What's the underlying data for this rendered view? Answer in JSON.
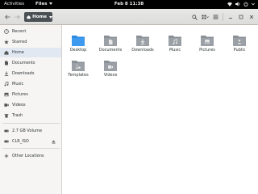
{
  "topbar": {
    "activities_label": "Activities",
    "app_menu_label": "Files",
    "clock": "Feb 8  11:38"
  },
  "headerbar": {
    "path_label": "Home"
  },
  "sidebar": {
    "items": [
      {
        "label": "Recent",
        "icon": "clock-icon"
      },
      {
        "label": "Starred",
        "icon": "star-icon"
      },
      {
        "label": "Home",
        "icon": "home-icon"
      },
      {
        "label": "Documents",
        "icon": "document-icon"
      },
      {
        "label": "Downloads",
        "icon": "download-icon"
      },
      {
        "label": "Music",
        "icon": "music-icon"
      },
      {
        "label": "Pictures",
        "icon": "picture-icon"
      },
      {
        "label": "Videos",
        "icon": "video-icon"
      },
      {
        "label": "Trash",
        "icon": "trash-icon"
      },
      {
        "label": "2.7 GB Volume",
        "icon": "drive-icon"
      },
      {
        "label": "CLR_ISO",
        "icon": "drive-icon"
      },
      {
        "label": "Other Locations",
        "icon": "plus-icon"
      }
    ],
    "active": "Home"
  },
  "folders": [
    {
      "label": "Desktop",
      "icon": "desktop-folder-icon",
      "color": "#2c8be0"
    },
    {
      "label": "Documents",
      "icon": "documents-folder-icon",
      "color": "#9aa0a6"
    },
    {
      "label": "Downloads",
      "icon": "downloads-folder-icon",
      "color": "#9aa0a6"
    },
    {
      "label": "Music",
      "icon": "music-folder-icon",
      "color": "#9aa0a6"
    },
    {
      "label": "Pictures",
      "icon": "pictures-folder-icon",
      "color": "#9aa0a6"
    },
    {
      "label": "Public",
      "icon": "public-folder-icon",
      "color": "#9aa0a6"
    },
    {
      "label": "Templates",
      "icon": "templates-folder-icon",
      "color": "#9aa0a6"
    },
    {
      "label": "Videos",
      "icon": "videos-folder-icon",
      "color": "#9aa0a6"
    }
  ],
  "colors": {
    "topbar": "#000000",
    "accent": "#2c8be0",
    "pathbar": "#4a4f54",
    "active_row": "#e1e8f2"
  }
}
